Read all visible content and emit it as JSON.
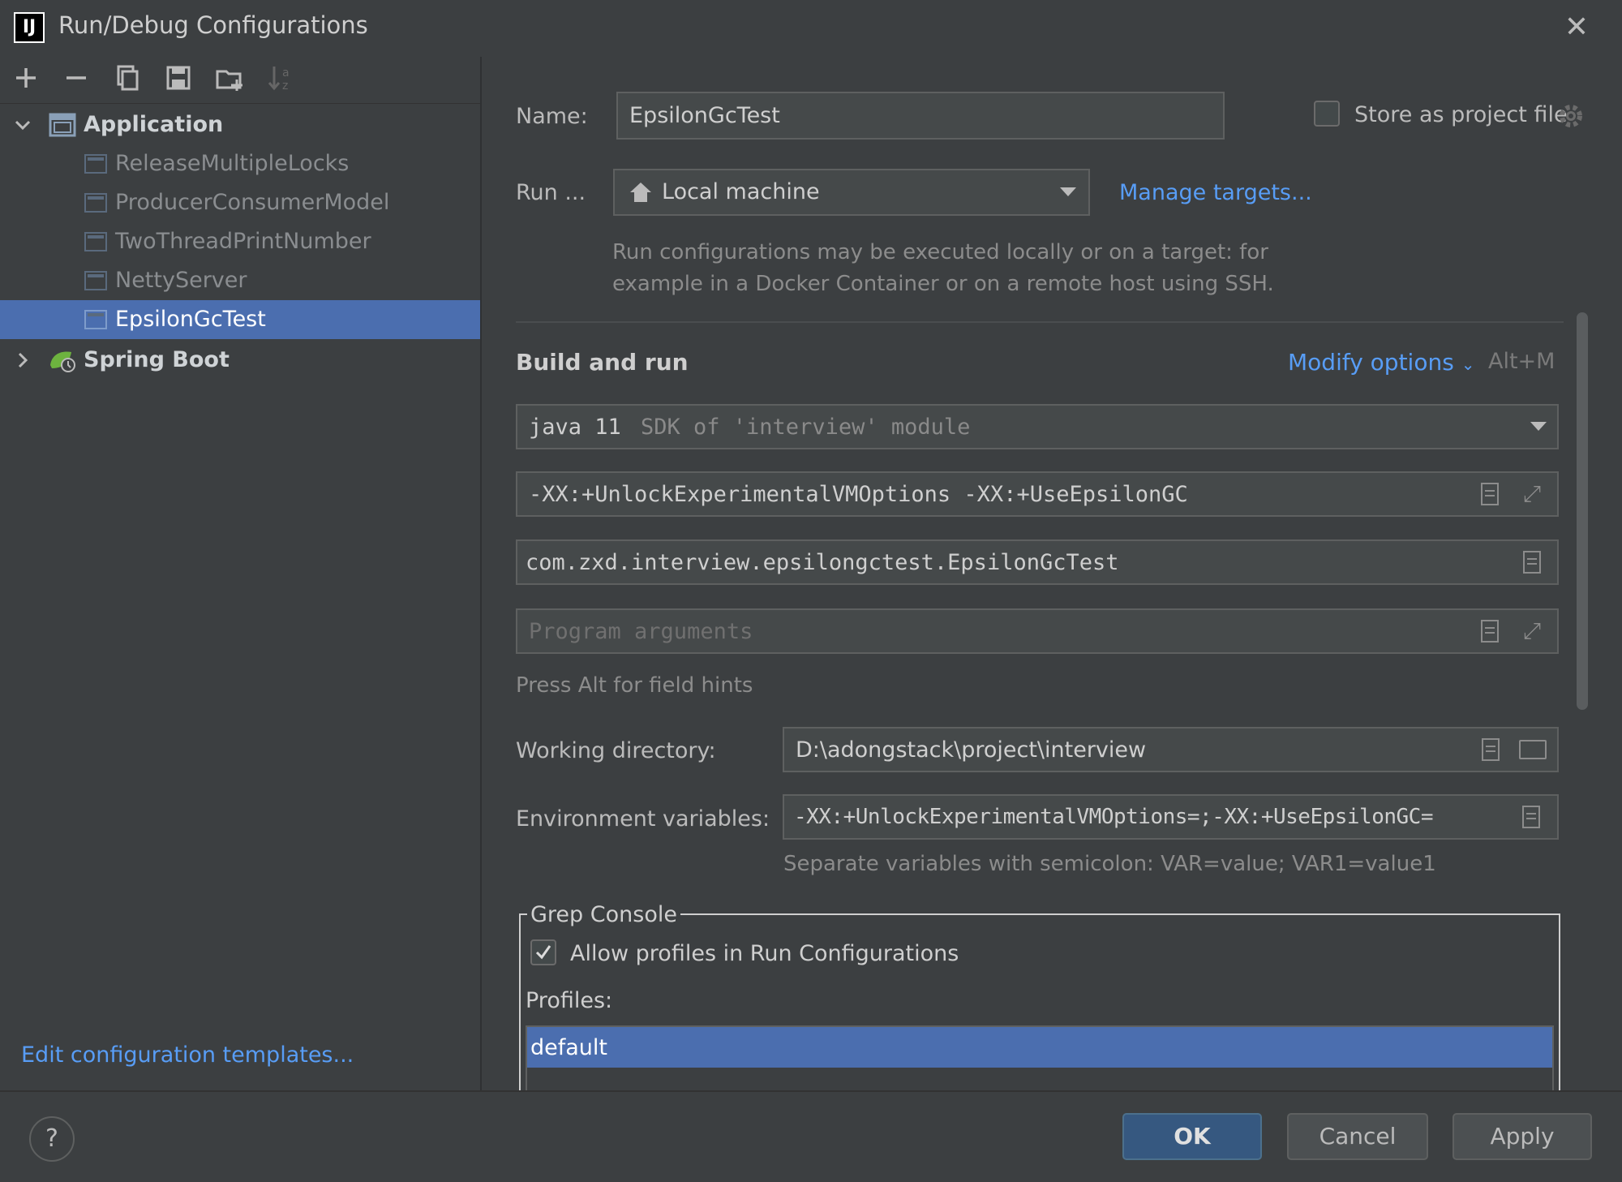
{
  "window": {
    "title": "Run/Debug Configurations",
    "logo_text": "IJ"
  },
  "toolbar": {
    "add": "+",
    "remove": "−",
    "sort": "↓a"
  },
  "tree": {
    "groups": [
      {
        "label": "Application",
        "expanded": true,
        "items": [
          "ReleaseMultipleLocks",
          "ProducerConsumerModel",
          "TwoThreadPrintNumber",
          "NettyServer",
          "EpsilonGcTest"
        ],
        "selected": "EpsilonGcTest"
      },
      {
        "label": "Spring Boot",
        "expanded": false,
        "items": []
      }
    ]
  },
  "edit_templates_link": "Edit configuration templates...",
  "form": {
    "name_label": "Name:",
    "name_value": "EpsilonGcTest",
    "store_label": "Store as project file",
    "store_checked": false,
    "run_on_label": "Run ...",
    "run_on_value": "Local machine",
    "manage_targets": "Manage targets...",
    "run_on_hint_1": "Run configurations may be executed locally or on a target: for",
    "run_on_hint_2": "example in a Docker Container or on a remote host using SSH.",
    "section_title": "Build and run",
    "modify_options": "Modify options",
    "modify_shortcut": "Alt+M",
    "sdk_value": "java 11",
    "sdk_hint": "SDK of 'interview' module",
    "vm_options": "-XX:+UnlockExperimentalVMOptions -XX:+UseEpsilonGC",
    "main_class": "com.zxd.interview.epsilongctest.EpsilonGcTest",
    "program_args_placeholder": "Program arguments",
    "field_hints": "Press Alt for field hints",
    "workdir_label": "Working directory:",
    "workdir_value": "D:\\adongstack\\project\\interview",
    "env_label": "Environment variables:",
    "env_value": "-XX:+UnlockExperimentalVMOptions=;-XX:+UseEpsilonGC=",
    "env_hint": "Separate variables with semicolon: VAR=value; VAR1=value1"
  },
  "grep_console": {
    "title": "Grep Console",
    "allow_profiles_label": "Allow profiles in Run Configurations",
    "allow_profiles_checked": true,
    "profiles_label": "Profiles:",
    "profiles": [
      "default"
    ],
    "selected_profile": "default"
  },
  "buttons": {
    "help": "?",
    "ok": "OK",
    "cancel": "Cancel",
    "apply": "Apply"
  },
  "colors": {
    "background": "#3c3f41",
    "selection": "#4b6eaf",
    "link": "#589df6",
    "primary_button": "#365880"
  }
}
